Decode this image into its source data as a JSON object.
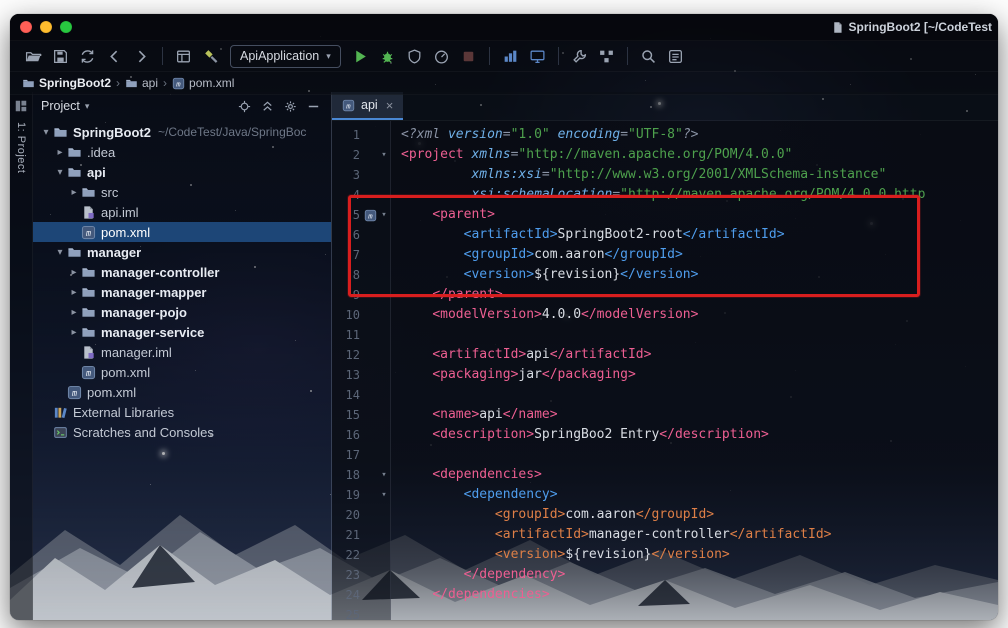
{
  "window": {
    "title": "SpringBoot2 [~/CodeTest",
    "title_icon": "file-icon",
    "traffic_lights": {
      "close": "#ff5f57",
      "minimize": "#febc2e",
      "zoom": "#28c840"
    }
  },
  "glyphs": {
    "arrow_down": "▾",
    "arrow_right": "▸",
    "crumb_sep": "›",
    "caret": "▾",
    "close": "×"
  },
  "colors": {
    "tag_pink": "#ee5f92",
    "tag_blue": "#4f9ded",
    "tag_orange": "#de7f47",
    "attr_blue": "#6fb0e8",
    "string_green": "#4ea14d",
    "code_text": "#d9dde4",
    "prolog_gray": "#8a93a5",
    "annotation": "#d81e1e",
    "selection": "#1d4677",
    "run_green": "#53b552"
  },
  "toolbar": {
    "run_config": {
      "label": "ApiApplication"
    },
    "items": [
      {
        "icon": "open-folder-icon"
      },
      {
        "icon": "save-icon"
      },
      {
        "icon": "sync-icon"
      },
      {
        "icon": "back-arrow-icon"
      },
      {
        "icon": "forward-arrow-icon"
      },
      {
        "sep": true
      },
      {
        "icon": "editor-layout-icon"
      },
      {
        "icon": "build-hammer-icon"
      },
      {
        "run_config": true
      },
      {
        "icon": "run-icon"
      },
      {
        "icon": "debug-icon"
      },
      {
        "icon": "coverage-icon"
      },
      {
        "icon": "profiler-icon"
      },
      {
        "icon": "stop-icon",
        "dim": true
      },
      {
        "sep": true
      },
      {
        "icon": "chart-icon"
      },
      {
        "icon": "monitor-icon"
      },
      {
        "sep": true
      },
      {
        "icon": "settings-wrench-icon"
      },
      {
        "icon": "project-structure-icon"
      },
      {
        "sep": true
      },
      {
        "icon": "search-icon"
      },
      {
        "icon": "find-action-icon"
      }
    ]
  },
  "breadcrumbs": {
    "separator": "›",
    "items": [
      {
        "icon": "folder-icon",
        "label": "SpringBoot2",
        "bold": true
      },
      {
        "icon": "folder-icon",
        "label": "api",
        "bold": false
      },
      {
        "icon": "maven-icon",
        "label": "pom.xml",
        "bold": false
      }
    ]
  },
  "tool_strip": {
    "icon": "project-tool-icon",
    "label": "1: Project"
  },
  "project_panel": {
    "header": "Project",
    "buttons": [
      {
        "icon": "locate-icon"
      },
      {
        "icon": "collapse-all-icon"
      },
      {
        "icon": "settings-gear-icon"
      },
      {
        "icon": "hide-panel-icon"
      }
    ],
    "tree": [
      {
        "depth": 0,
        "arrow": "down",
        "icon": "folder-icon",
        "label": "SpringBoot2",
        "bold": true,
        "sub": "~/CodeTest/Java/SpringBoc"
      },
      {
        "depth": 1,
        "arrow": "right",
        "icon": "folder-icon",
        "label": ".idea"
      },
      {
        "depth": 1,
        "arrow": "down",
        "icon": "folder-icon",
        "label": "api",
        "bold": true
      },
      {
        "depth": 2,
        "arrow": "right",
        "icon": "folder-icon",
        "label": "src"
      },
      {
        "depth": 2,
        "icon": "iml-icon",
        "label": "api.iml"
      },
      {
        "depth": 2,
        "icon": "maven-icon",
        "label": "pom.xml",
        "selected": true
      },
      {
        "depth": 1,
        "arrow": "down",
        "icon": "folder-icon",
        "label": "manager",
        "bold": true
      },
      {
        "depth": 2,
        "arrow": "right",
        "icon": "folder-icon",
        "label": "manager-controller",
        "bold": true
      },
      {
        "depth": 2,
        "arrow": "right",
        "icon": "folder-icon",
        "label": "manager-mapper",
        "bold": true
      },
      {
        "depth": 2,
        "arrow": "right",
        "icon": "folder-icon",
        "label": "manager-pojo",
        "bold": true
      },
      {
        "depth": 2,
        "arrow": "right",
        "icon": "folder-icon",
        "label": "manager-service",
        "bold": true
      },
      {
        "depth": 2,
        "icon": "iml-icon",
        "label": "manager.iml"
      },
      {
        "depth": 2,
        "icon": "maven-icon",
        "label": "pom.xml"
      },
      {
        "depth": 1,
        "icon": "maven-icon",
        "label": "pom.xml"
      },
      {
        "depth": 0,
        "icon": "lib-icon",
        "label": "External Libraries"
      },
      {
        "depth": 0,
        "icon": "scratch-icon",
        "label": "Scratches and Consoles"
      }
    ]
  },
  "editor": {
    "tab": {
      "icon": "maven-icon",
      "label": "api"
    },
    "gutter": {
      "maven_icon_line": 5,
      "fold_marker_lines": [
        2,
        5,
        18,
        19
      ],
      "line_count": 25
    },
    "lines": [
      [
        [
          "pl",
          "<?xml "
        ],
        [
          "at",
          "version"
        ],
        [
          "pl",
          "="
        ],
        [
          "st",
          "\"1.0\""
        ],
        [
          "pl",
          " "
        ],
        [
          "at",
          "encoding"
        ],
        [
          "pl",
          "="
        ],
        [
          "st",
          "\"UTF-8\""
        ],
        [
          "pl",
          "?>"
        ]
      ],
      [
        [
          "pt",
          "<project "
        ],
        [
          "at",
          "xmlns"
        ],
        [
          "pl",
          "="
        ],
        [
          "st",
          "\"http://maven.apache.org/POM/4.0.0\""
        ]
      ],
      [
        [
          "tx",
          "         "
        ],
        [
          "at",
          "xmlns:xsi"
        ],
        [
          "pl",
          "="
        ],
        [
          "st",
          "\"http://www.w3.org/2001/XMLSchema-instance\""
        ]
      ],
      [
        [
          "tx",
          "         "
        ],
        [
          "at",
          "xsi:schemaLocation"
        ],
        [
          "pl",
          "="
        ],
        [
          "st",
          "\"http://maven.apache.org/POM/4.0.0 http"
        ]
      ],
      [
        [
          "tx",
          "    "
        ],
        [
          "pt",
          "<parent>"
        ]
      ],
      [
        [
          "tx",
          "        "
        ],
        [
          "bt",
          "<artifactId>"
        ],
        [
          "tx",
          "SpringBoot2-root"
        ],
        [
          "bt",
          "</artifactId>"
        ]
      ],
      [
        [
          "tx",
          "        "
        ],
        [
          "bt",
          "<groupId>"
        ],
        [
          "tx",
          "com.aaron"
        ],
        [
          "bt",
          "</groupId>"
        ]
      ],
      [
        [
          "tx",
          "        "
        ],
        [
          "bt",
          "<version>"
        ],
        [
          "tx",
          "${revision}"
        ],
        [
          "bt",
          "</version>"
        ]
      ],
      [
        [
          "tx",
          "    "
        ],
        [
          "pt",
          "</parent>"
        ]
      ],
      [
        [
          "tx",
          "    "
        ],
        [
          "pt",
          "<modelVersion>"
        ],
        [
          "tx",
          "4.0.0"
        ],
        [
          "pt",
          "</modelVersion>"
        ]
      ],
      [],
      [
        [
          "tx",
          "    "
        ],
        [
          "pt",
          "<artifactId>"
        ],
        [
          "tx",
          "api"
        ],
        [
          "pt",
          "</artifactId>"
        ]
      ],
      [
        [
          "tx",
          "    "
        ],
        [
          "pt",
          "<packaging>"
        ],
        [
          "tx",
          "jar"
        ],
        [
          "pt",
          "</packaging>"
        ]
      ],
      [],
      [
        [
          "tx",
          "    "
        ],
        [
          "pt",
          "<name>"
        ],
        [
          "tx",
          "api"
        ],
        [
          "pt",
          "</name>"
        ]
      ],
      [
        [
          "tx",
          "    "
        ],
        [
          "pt",
          "<description>"
        ],
        [
          "tx",
          "SpringBoo2 Entry"
        ],
        [
          "pt",
          "</description>"
        ]
      ],
      [],
      [
        [
          "tx",
          "    "
        ],
        [
          "pt",
          "<dependencies>"
        ]
      ],
      [
        [
          "tx",
          "        "
        ],
        [
          "bt",
          "<dependency>"
        ]
      ],
      [
        [
          "tx",
          "            "
        ],
        [
          "ot",
          "<groupId>"
        ],
        [
          "tx",
          "com.aaron"
        ],
        [
          "ot",
          "</groupId>"
        ]
      ],
      [
        [
          "tx",
          "            "
        ],
        [
          "ot",
          "<artifactId>"
        ],
        [
          "tx",
          "manager-controller"
        ],
        [
          "ot",
          "</artifactId>"
        ]
      ],
      [
        [
          "tx",
          "            "
        ],
        [
          "ot",
          "<version>"
        ],
        [
          "tx",
          "${revision}"
        ],
        [
          "ot",
          "</version>"
        ]
      ],
      [
        [
          "tx",
          "        "
        ],
        [
          "pt",
          "</dependency>"
        ]
      ],
      [
        [
          "tx",
          "    "
        ],
        [
          "pt",
          "</dependencies>"
        ]
      ],
      []
    ]
  }
}
